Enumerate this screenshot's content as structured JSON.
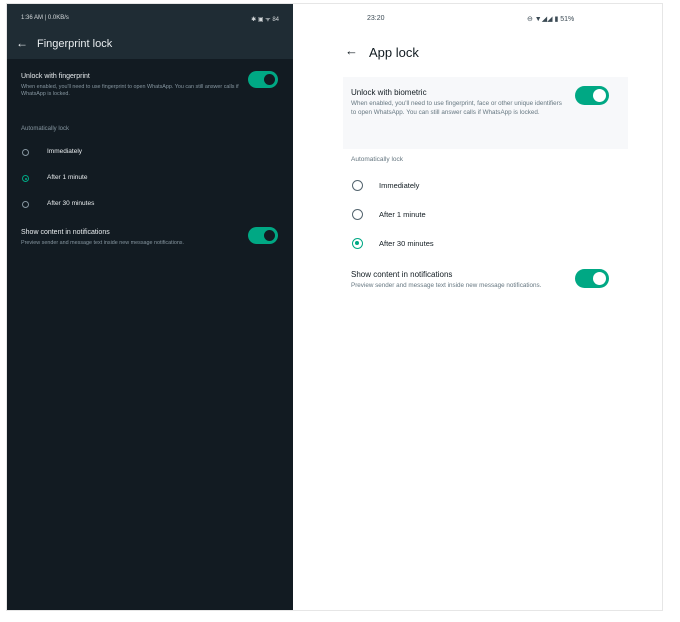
{
  "dark": {
    "status_left": "1:36 AM | 0.0KB/s",
    "status_right": "✱ ▣ ᯤ 84",
    "title": "Fingerprint lock",
    "unlock": {
      "title": "Unlock with fingerprint",
      "subtitle": "When enabled, you'll need to use fingerprint to open WhatsApp. You can still answer calls if WhatsApp is locked.",
      "enabled": true
    },
    "section_label": "Automatically lock",
    "options": [
      "Immediately",
      "After 1 minute",
      "After 30 minutes"
    ],
    "selected_option": "After 1 minute",
    "notifications": {
      "title": "Show content in notifications",
      "subtitle": "Preview sender and message text inside new message notifications.",
      "enabled": true
    }
  },
  "light": {
    "status_left": "23:20",
    "status_right": "⊖ ▼◢◢ ▮ 51%",
    "title": "App lock",
    "unlock": {
      "title": "Unlock with biometric",
      "subtitle": "When enabled, you'll need to use fingerprint, face or other unique identifiers to open WhatsApp. You can still answer calls if WhatsApp is locked.",
      "enabled": true
    },
    "section_label": "Automatically lock",
    "options": [
      "Immediately",
      "After 1 minute",
      "After 30 minutes"
    ],
    "selected_option": "After 30 minutes",
    "notifications": {
      "title": "Show content in notifications",
      "subtitle": "Preview sender and message text inside new message notifications.",
      "enabled": true
    }
  },
  "colors": {
    "accent": "#00a884",
    "dark_bg": "#121b22",
    "dark_bar": "#1f2c34"
  },
  "icons": {
    "back": "arrow-left-icon"
  }
}
